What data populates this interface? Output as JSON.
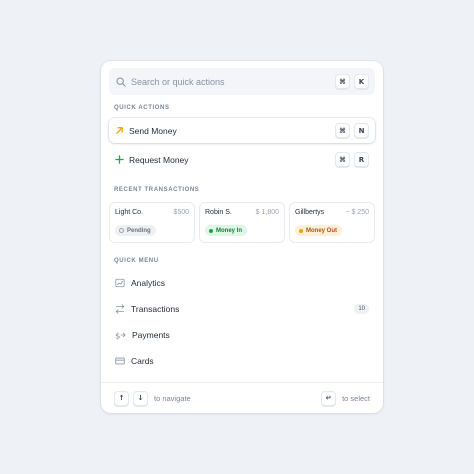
{
  "search": {
    "placeholder": "Search or quick actions",
    "shortcut_mod": "⌘",
    "shortcut_key": "K"
  },
  "quick_actions": {
    "heading": "QUICK ACTIONS",
    "items": [
      {
        "label": "Send Money",
        "icon": "arrow-up-right-icon",
        "shortcut_mod": "⌘",
        "shortcut_key": "N",
        "selected": true
      },
      {
        "label": "Request Money",
        "icon": "plus-icon",
        "shortcut_mod": "⌘",
        "shortcut_key": "R",
        "selected": false
      }
    ]
  },
  "recent_transactions": {
    "heading": "RECENT TRANSACTIONS",
    "items": [
      {
        "name": "Light Co.",
        "amount": "$500",
        "status": "Pending"
      },
      {
        "name": "Robin S.",
        "amount": "$ 1,800",
        "status": "Money In"
      },
      {
        "name": "Gillbertys",
        "amount": "− $ 250",
        "status": "Money Out"
      }
    ]
  },
  "quick_menu": {
    "heading": "QUICK MENU",
    "items": [
      {
        "label": "Analytics",
        "icon": "chart-icon"
      },
      {
        "label": "Transactions",
        "icon": "swap-arrows-icon",
        "count": "10"
      },
      {
        "label": "Payments",
        "icon": "dollar-arrow-icon"
      },
      {
        "label": "Cards",
        "icon": "card-icon"
      }
    ]
  },
  "footer": {
    "up_key": "↑",
    "down_key": "↓",
    "navigate_hint": "to navigate",
    "enter_key": "↵",
    "select_hint": "to select"
  },
  "colors": {
    "background": "#eef1f6",
    "send_icon": "#f59e0b",
    "request_icon": "#22a34a"
  }
}
